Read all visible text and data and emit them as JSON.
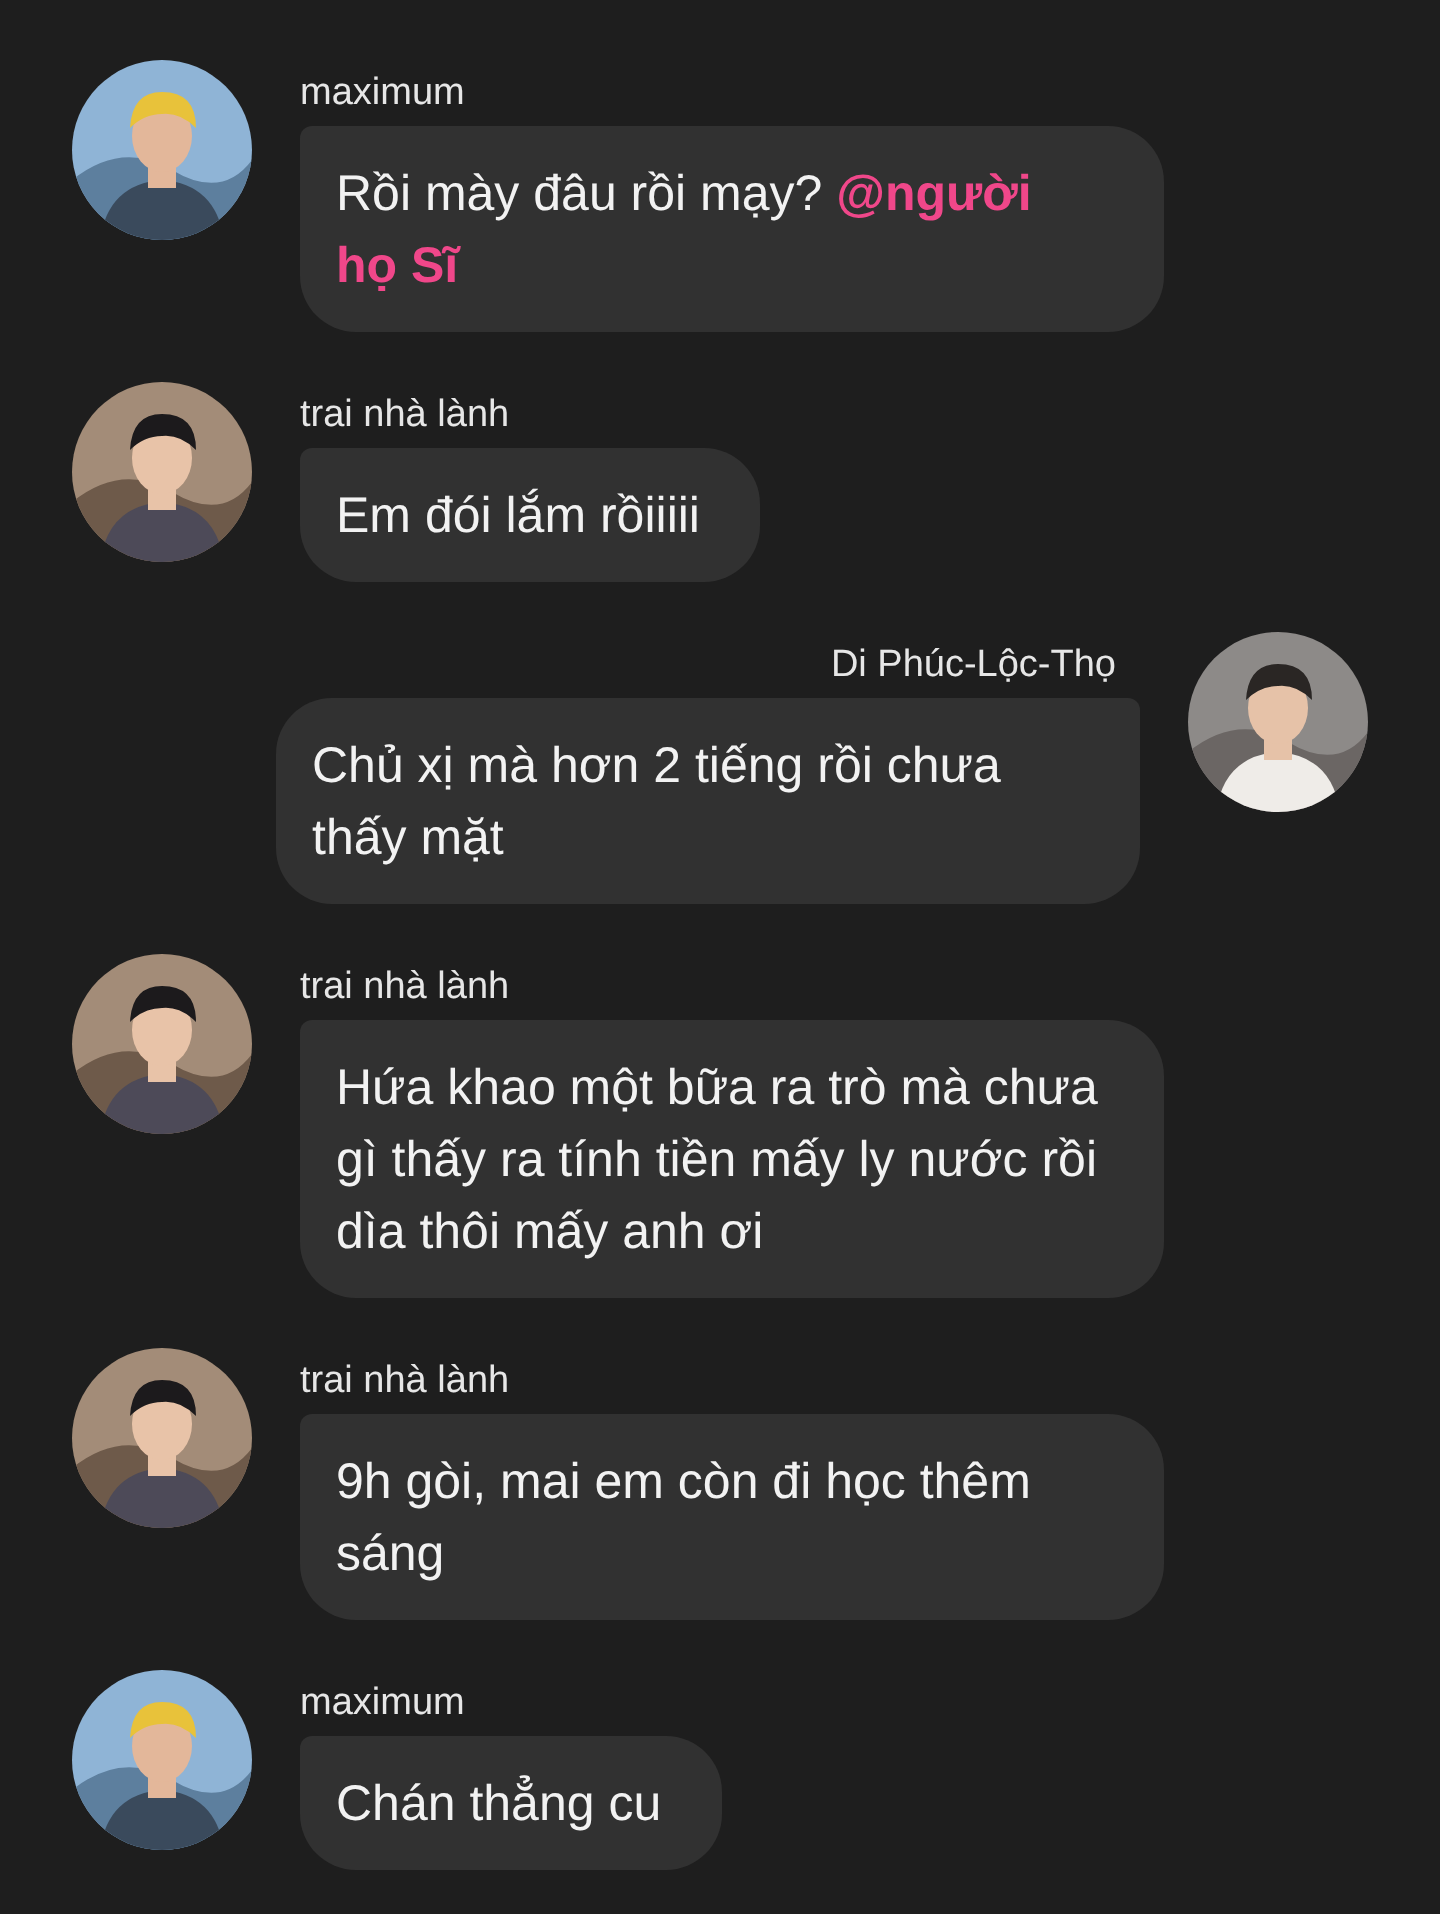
{
  "messages": [
    {
      "sender": "maximum",
      "kind": "incoming",
      "parts": [
        {
          "kind": "plain",
          "text": "Rồi mày đâu rồi mạy? "
        },
        {
          "kind": "mention",
          "text": "@người họ Sĩ"
        }
      ]
    },
    {
      "sender": "trai nhà lành",
      "kind": "incoming",
      "parts": [
        {
          "kind": "plain",
          "text": "Em đói lắm rồiiiii"
        }
      ]
    },
    {
      "sender": "Di Phúc-Lộc-Thọ",
      "kind": "outgoing",
      "parts": [
        {
          "kind": "plain",
          "text": "Chủ xị mà hơn 2 tiếng rồi chưa thấy mặt"
        }
      ]
    },
    {
      "sender": "trai nhà lành",
      "kind": "incoming",
      "parts": [
        {
          "kind": "plain",
          "text": "Hứa khao một bữa ra trò mà chưa gì thấy ra tính tiền mấy ly nước rồi dìa thôi mấy anh ơi"
        }
      ]
    },
    {
      "sender": "trai nhà lành",
      "kind": "incoming",
      "parts": [
        {
          "kind": "plain",
          "text": "9h gòi, mai em còn đi học thêm sáng"
        }
      ]
    },
    {
      "sender": "maximum",
      "kind": "incoming",
      "parts": [
        {
          "kind": "plain",
          "text": "Chán thẳng cu"
        }
      ]
    }
  ]
}
